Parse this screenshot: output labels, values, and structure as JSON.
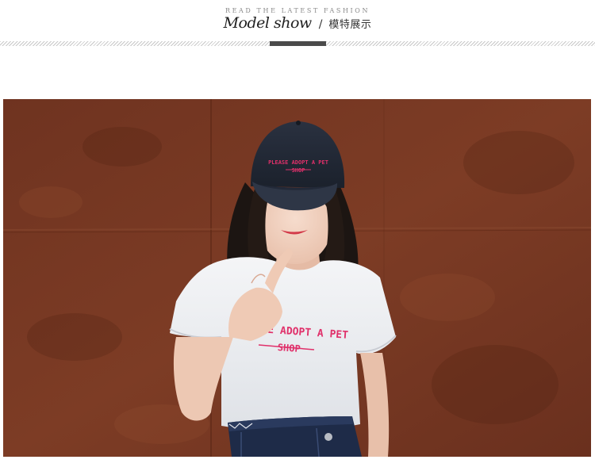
{
  "header": {
    "tagline": "READ THE LATEST FASHION",
    "title_en": "Model show",
    "separator": "/",
    "title_cn": "模特展示"
  },
  "photo": {
    "cap_text_line1": "PLEASE ADOPT A PET",
    "cap_text_line2": "SHOP",
    "shirt_text_line1": "SE ADOPT A PET",
    "shirt_text_line2": "SHOP"
  },
  "colors": {
    "wall": "#7a3a24",
    "accent": "#4a4a4a",
    "print": "#e0306a"
  }
}
